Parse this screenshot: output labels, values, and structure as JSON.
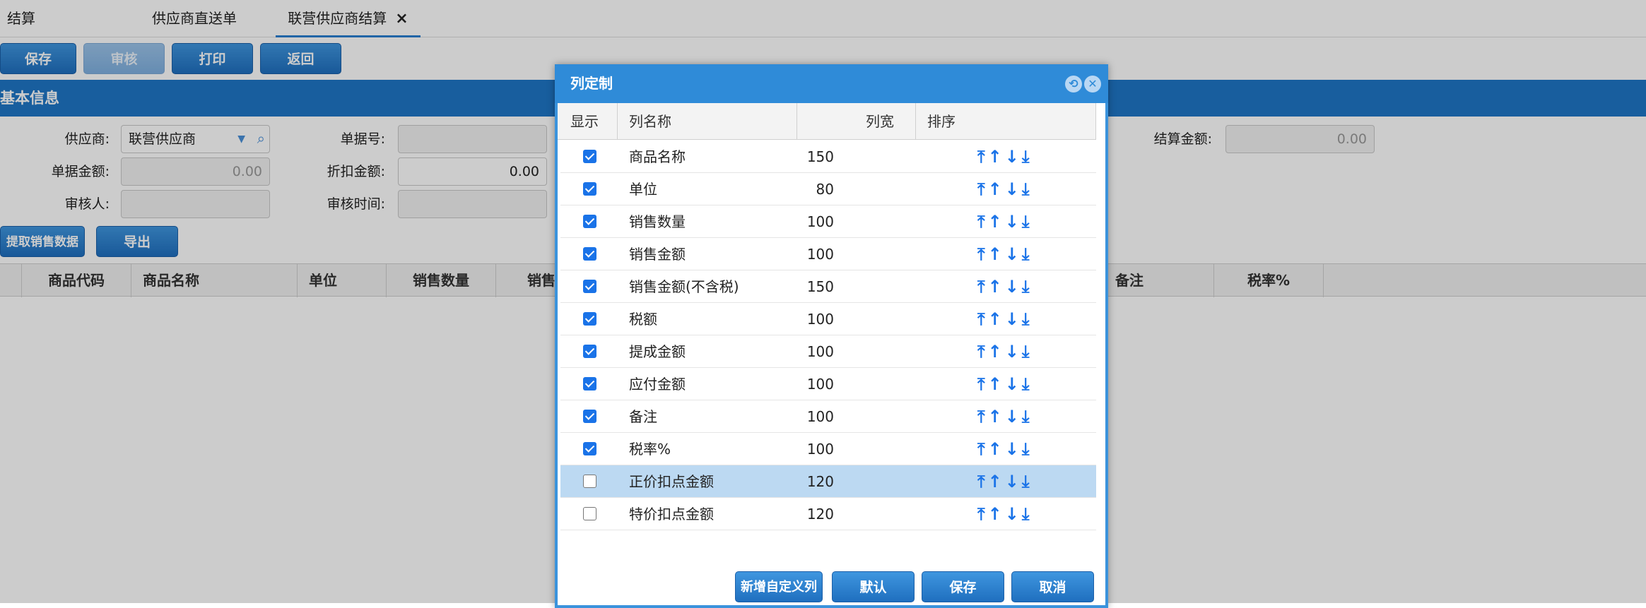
{
  "tabs": [
    {
      "label": "结算"
    },
    {
      "label": "供应商直送单"
    },
    {
      "label": "联营供应商结算",
      "close": "×"
    }
  ],
  "toolbar": {
    "save": "保存",
    "audit": "审核",
    "print": "打印",
    "back": "返回"
  },
  "section_title": "基本信息",
  "form": {
    "supplier_label": "供应商:",
    "supplier_value": "联营供应商",
    "doc_no_label": "单据号:",
    "doc_no_value": "",
    "settle_amount_label": "结算金额:",
    "settle_amount_value": "0.00",
    "doc_amount_label": "单据金额:",
    "doc_amount_value": "0.00",
    "discount_label": "折扣金额:",
    "discount_value": "0.00",
    "auditor_label": "审核人:",
    "auditor_value": "",
    "audit_time_label": "审核时间:",
    "audit_time_value": ""
  },
  "actions": {
    "extract": "提取销售数据",
    "export": "导出"
  },
  "grid_headers": [
    "商品代码",
    "商品名称",
    "单位",
    "销售数量",
    "销售",
    "备注",
    "税率%"
  ],
  "dialog": {
    "title": "列定制",
    "headers": {
      "show": "显示",
      "name": "列名称",
      "width": "列宽",
      "sort": "排序"
    },
    "rows": [
      {
        "name": "商品名称",
        "width": "150",
        "checked": true
      },
      {
        "name": "单位",
        "width": "80",
        "checked": true
      },
      {
        "name": "销售数量",
        "width": "100",
        "checked": true
      },
      {
        "name": "销售金额",
        "width": "100",
        "checked": true
      },
      {
        "name": "销售金额(不含税)",
        "width": "150",
        "checked": true
      },
      {
        "name": "税额",
        "width": "100",
        "checked": true
      },
      {
        "name": "提成金额",
        "width": "100",
        "checked": true
      },
      {
        "name": "应付金额",
        "width": "100",
        "checked": true
      },
      {
        "name": "备注",
        "width": "100",
        "checked": true
      },
      {
        "name": "税率%",
        "width": "100",
        "checked": true
      },
      {
        "name": "正价扣点金额",
        "width": "120",
        "checked": false,
        "selected": true
      },
      {
        "name": "特价扣点金额",
        "width": "120",
        "checked": false
      }
    ],
    "sort_arrows": "⤒↑↓⤓",
    "buttons": {
      "add_custom": "新增自定义列",
      "default": "默认",
      "save": "保存",
      "cancel": "取消"
    }
  },
  "colors": {
    "primary": "#1f76c6",
    "dialog_title": "#2f8bd8",
    "selected_row": "#bcd9f2",
    "checkbox": "#1a73e8"
  }
}
